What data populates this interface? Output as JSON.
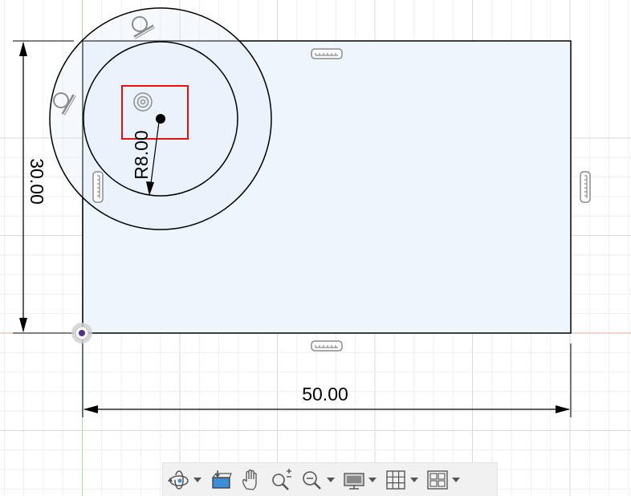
{
  "app": {
    "view": "sketch-canvas"
  },
  "colors": {
    "grid_minor": "#eeeeee",
    "grid_major": "#d9d9d9",
    "profile_fill": "#eef6fd",
    "line": "#000000",
    "x_axis": "#e8a6a6",
    "y_axis": "#a7dba7",
    "selection_box": "#e8120c",
    "constraint_icon": "#8c8c8c",
    "origin": "#5a2c8a",
    "toolbar_bg": "#f1f1f1",
    "toolbar_icon": "#555555",
    "toolbar_accent": "#3c8dd6"
  },
  "dimensions": {
    "height_label": "30.00",
    "width_label": "50.00",
    "radius_label": "R8.00"
  },
  "toolbar": {
    "buttons": [
      {
        "name": "orbit-button",
        "icon": "orbit-icon",
        "dropdown": true
      },
      {
        "name": "look-at-button",
        "icon": "look-at-icon",
        "dropdown": false
      },
      {
        "name": "pan-button",
        "icon": "hand-pan-icon",
        "dropdown": false
      },
      {
        "name": "zoom-button",
        "icon": "zoom-plus-minus-icon",
        "dropdown": false
      },
      {
        "name": "fit-button",
        "icon": "zoom-window-icon",
        "dropdown": true
      },
      {
        "name": "display-settings-button",
        "icon": "monitor-icon",
        "dropdown": true
      },
      {
        "name": "grid-snaps-button",
        "icon": "grid-icon",
        "dropdown": true
      },
      {
        "name": "viewports-button",
        "icon": "viewports-icon",
        "dropdown": true
      }
    ]
  }
}
